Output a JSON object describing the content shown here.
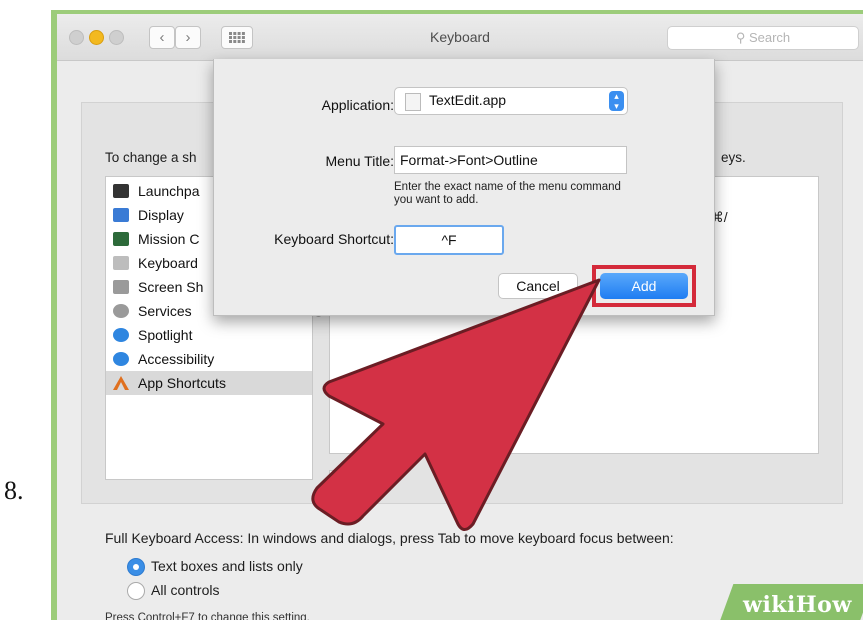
{
  "step_number": "8.",
  "window": {
    "title": "Keyboard",
    "search_placeholder": "Search",
    "nav_back": "‹",
    "nav_forward": "›"
  },
  "panel": {
    "instruction_prefix": "To change a sh",
    "instruction_suffix": "eys.",
    "shortcut_keys": "⇧⌘/"
  },
  "sidebar": {
    "items": [
      {
        "label": "Launchpa",
        "icon": "launchpad-icon",
        "color": "#333333"
      },
      {
        "label": "Display",
        "icon": "display-icon",
        "color": "#3a7bd5"
      },
      {
        "label": "Mission C",
        "icon": "mission-control-icon",
        "color": "#2d6a3a"
      },
      {
        "label": "Keyboard",
        "icon": "keyboard-icon",
        "color": "#bdbdbd"
      },
      {
        "label": "Screen Sh",
        "icon": "screenshot-icon",
        "color": "#9a9a9a"
      },
      {
        "label": "Services",
        "icon": "gear-icon",
        "color": "#9a9a9a"
      },
      {
        "label": "Spotlight",
        "icon": "spotlight-icon",
        "color": "#2f86e0"
      },
      {
        "label": "Accessibility",
        "icon": "accessibility-icon",
        "color": "#2f86e0"
      },
      {
        "label": "App Shortcuts",
        "icon": "app-shortcuts-icon",
        "color": "#e0701f",
        "selected": true
      }
    ]
  },
  "dialog": {
    "application_label": "Application:",
    "application_value": "TextEdit.app",
    "menu_title_label": "Menu Title:",
    "menu_title_value": "Format->Font>Outline",
    "hint": "Enter the exact name of the menu command\nyou want to add.",
    "shortcut_label": "Keyboard Shortcut:",
    "shortcut_value": "^F",
    "cancel_label": "Cancel",
    "add_label": "Add"
  },
  "footer": {
    "full_keyboard_access": "Full Keyboard Access: In windows and dialogs, press Tab to move keyboard focus between:",
    "option_text_boxes": "Text boxes and lists only",
    "option_all_controls": "All controls",
    "press_note": "Press Control+F7 to change this setting."
  },
  "watermark": "wikiHow",
  "colors": {
    "accent": "#1f7df2",
    "highlight": "#d42a3a",
    "arrow": "#d33145",
    "frame": "#9ccc7a"
  }
}
